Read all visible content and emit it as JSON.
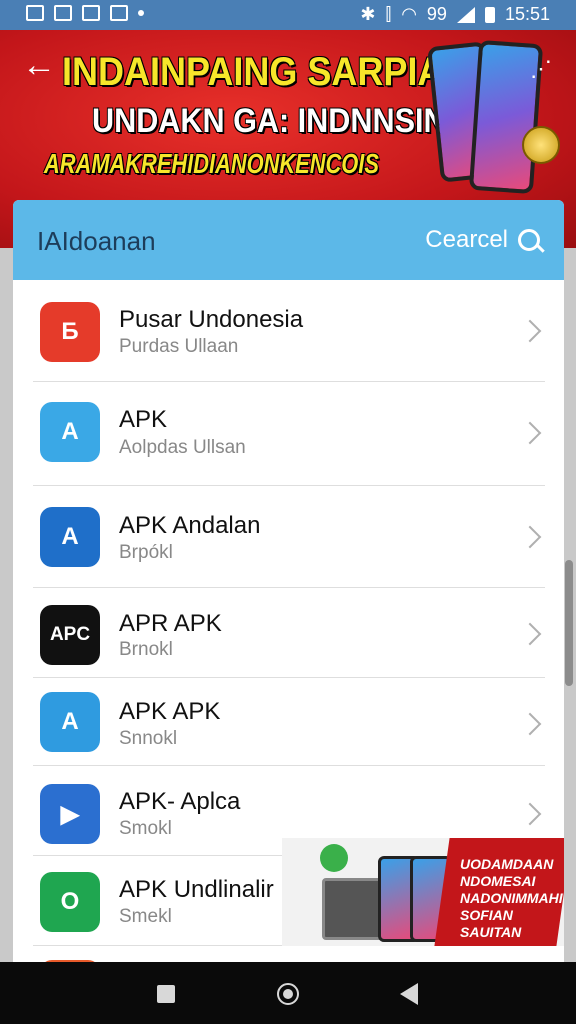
{
  "status_bar": {
    "time": "15:51",
    "battery_text": "99"
  },
  "banner": {
    "line1": "INDAINPAING SARPIA",
    "line2": "UNDAKN GA: INDNNSIN",
    "line3": "ARAMAKREHIDIANONKENCOIS"
  },
  "header": {
    "title": "IAIdoanan",
    "search_label": "Cearcel"
  },
  "apps": [
    {
      "name": "Pusar Undonesia",
      "subtitle": "Purdas Ullaan",
      "icon_label": "Б",
      "color": "#e53b2a"
    },
    {
      "name": "APK",
      "subtitle": "Aolpdas Ullsan",
      "icon_label": "A",
      "color": "#3aa8e6"
    },
    {
      "name": "APK Andalan",
      "subtitle": "Brpókl",
      "icon_label": "A",
      "color": "#1f6fc9"
    },
    {
      "name": "APR APK",
      "subtitle": "Brnokl",
      "icon_label": "APC",
      "color": "#111111"
    },
    {
      "name": "APK APK",
      "subtitle": "Snnokl",
      "icon_label": "A",
      "color": "#2f9be0"
    },
    {
      "name": "APK- Aplca",
      "subtitle": "Smokl",
      "icon_label": "▶",
      "color": "#2b6fd0"
    },
    {
      "name": "APK Undlinalir",
      "subtitle": "Smekl",
      "icon_label": "O",
      "color": "#1fa650"
    }
  ],
  "ad": {
    "text": "UODAMDAAN NDOMESAI NADONIMMAHI SOFIAN SAUITAN"
  }
}
